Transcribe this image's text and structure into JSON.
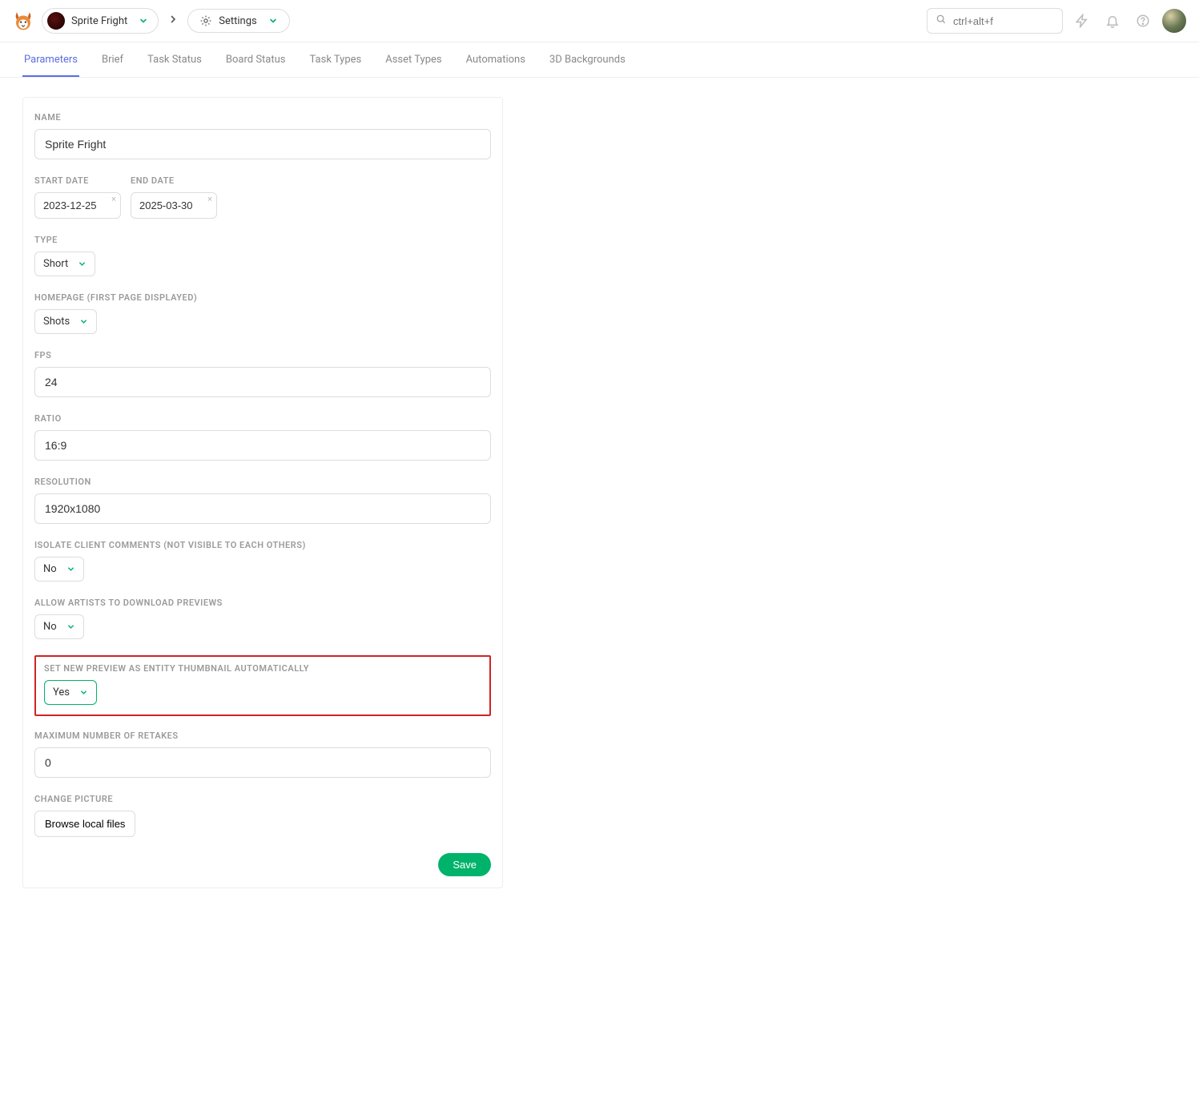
{
  "header": {
    "project_name": "Sprite Fright",
    "settings_label": "Settings",
    "search_placeholder": "ctrl+alt+f"
  },
  "tabs": [
    "Parameters",
    "Brief",
    "Task Status",
    "Board Status",
    "Task Types",
    "Asset Types",
    "Automations",
    "3D Backgrounds"
  ],
  "active_tab_index": 0,
  "form": {
    "labels": {
      "name": "Name",
      "start_date": "Start Date",
      "end_date": "End Date",
      "type": "Type",
      "homepage": "Homepage (first page displayed)",
      "fps": "FPS",
      "ratio": "Ratio",
      "resolution": "Resolution",
      "isolate": "Isolate client comments (not visible to each others)",
      "allow_dl": "Allow artists to download previews",
      "auto_thumb": "Set new preview as entity thumbnail automatically",
      "max_retakes": "Maximum number of retakes",
      "change_pic": "Change Picture"
    },
    "values": {
      "name": "Sprite Fright",
      "start_date": "2023-12-25",
      "end_date": "2025-03-30",
      "type": "Short",
      "homepage": "Shots",
      "fps": "24",
      "ratio": "16:9",
      "resolution": "1920x1080",
      "isolate": "No",
      "allow_dl": "No",
      "auto_thumb": "Yes",
      "max_retakes": "0"
    },
    "browse_label": "Browse local files",
    "save_label": "Save"
  }
}
